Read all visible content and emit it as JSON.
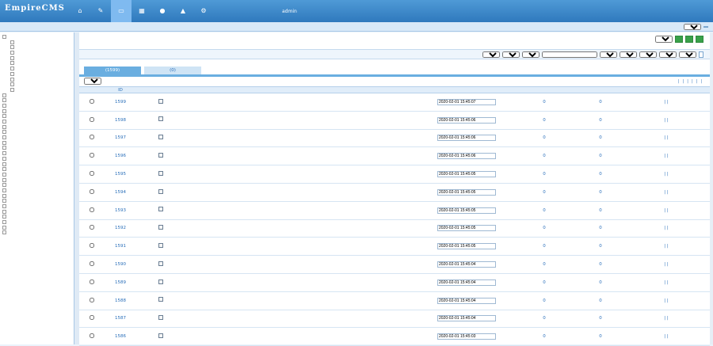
{
  "header": {
    "logo": "EmpireCMS",
    "nav": [
      {
        "label": "",
        "icon": "home-icon",
        "active": false
      },
      {
        "label": "",
        "icon": "edit-icon",
        "active": false
      },
      {
        "label": "",
        "icon": "folder-icon",
        "active": true
      },
      {
        "label": "",
        "icon": "template-icon",
        "active": false
      },
      {
        "label": "",
        "icon": "user-icon",
        "active": false
      },
      {
        "label": "",
        "icon": "plugin-icon",
        "active": false
      },
      {
        "label": "",
        "icon": "gear-icon",
        "active": false
      }
    ],
    "info": [
      "",
      "admin",
      ""
    ]
  },
  "subnav": {
    "items": [
      "",
      "",
      "",
      "",
      "",
      "",
      "",
      "",
      "",
      "",
      "",
      "",
      "",
      "",
      "",
      "",
      ""
    ],
    "right_label": "",
    "select": "",
    "btn": ""
  },
  "sidebar": {
    "items": [
      "",
      "",
      "",
      "",
      "",
      "",
      "",
      "",
      "",
      "",
      "",
      "",
      "",
      "",
      "",
      "",
      "",
      "",
      "",
      "",
      "",
      "",
      "",
      "",
      "",
      "",
      "",
      "",
      "",
      "",
      "",
      "",
      "",
      "",
      "",
      "",
      "",
      ""
    ]
  },
  "main": {
    "crumb_prefix": "",
    "crumb_link": "",
    "actions": {
      "select": "",
      "btn1": "",
      "btn2": "",
      "btn3": ""
    },
    "search": {
      "label": "",
      "selects": [
        "",
        "",
        "",
        ""
      ],
      "placeholder": "",
      "selects2": [
        "",
        "",
        "",
        "",
        ""
      ],
      "btn": ""
    },
    "tabs": [
      {
        "label": "",
        "count": "1599"
      },
      {
        "label": "",
        "count": "0"
      }
    ],
    "sort": "",
    "toplinks": [
      "",
      "",
      "",
      "",
      "",
      "",
      ""
    ],
    "columns": [
      "ID",
      "",
      "",
      "",
      "",
      "",
      ""
    ],
    "rows": [
      {
        "id": "1599",
        "title": "",
        "cat": "",
        "pub": "",
        "time": "2020-02-01 15:45:07",
        "clicks": "0",
        "cmt": "0"
      },
      {
        "id": "1598",
        "title": "",
        "cat": "",
        "pub": "",
        "time": "2020-02-01 15:45:06",
        "clicks": "0",
        "cmt": "0"
      },
      {
        "id": "1597",
        "title": "",
        "cat": "",
        "pub": "",
        "time": "2020-02-01 15:45:06",
        "clicks": "0",
        "cmt": "0"
      },
      {
        "id": "1596",
        "title": "",
        "cat": "",
        "pub": "",
        "time": "2020-02-01 15:45:06",
        "clicks": "0",
        "cmt": "0"
      },
      {
        "id": "1595",
        "title": "",
        "cat": "",
        "pub": "",
        "time": "2020-02-01 15:45:05",
        "clicks": "0",
        "cmt": "0"
      },
      {
        "id": "1594",
        "title": "",
        "cat": "",
        "pub": "",
        "time": "2020-02-01 15:45:05",
        "clicks": "0",
        "cmt": "0"
      },
      {
        "id": "1593",
        "title": "",
        "cat": "",
        "pub": "",
        "time": "2020-02-01 15:45:05",
        "clicks": "0",
        "cmt": "0"
      },
      {
        "id": "1592",
        "title": "",
        "cat": "",
        "pub": "",
        "time": "2020-02-01 15:45:05",
        "clicks": "0",
        "cmt": "0"
      },
      {
        "id": "1591",
        "title": "",
        "cat": "",
        "pub": "",
        "time": "2020-02-01 15:45:05",
        "clicks": "0",
        "cmt": "0"
      },
      {
        "id": "1590",
        "title": "",
        "cat": "",
        "pub": "",
        "time": "2020-02-01 15:45:04",
        "clicks": "0",
        "cmt": "0"
      },
      {
        "id": "1589",
        "title": "",
        "cat": "",
        "pub": "",
        "time": "2020-02-01 15:45:04",
        "clicks": "0",
        "cmt": "0"
      },
      {
        "id": "1588",
        "title": "",
        "cat": "",
        "pub": "",
        "time": "2020-02-01 15:45:04",
        "clicks": "0",
        "cmt": "0"
      },
      {
        "id": "1587",
        "title": "",
        "cat": "",
        "pub": "",
        "time": "2020-02-01 15:45:04",
        "clicks": "0",
        "cmt": "0"
      },
      {
        "id": "1586",
        "title": "",
        "cat": "",
        "pub": "",
        "time": "2020-02-01 15:45:03",
        "clicks": "0",
        "cmt": "0"
      }
    ],
    "ops": [
      "",
      "",
      ""
    ]
  }
}
